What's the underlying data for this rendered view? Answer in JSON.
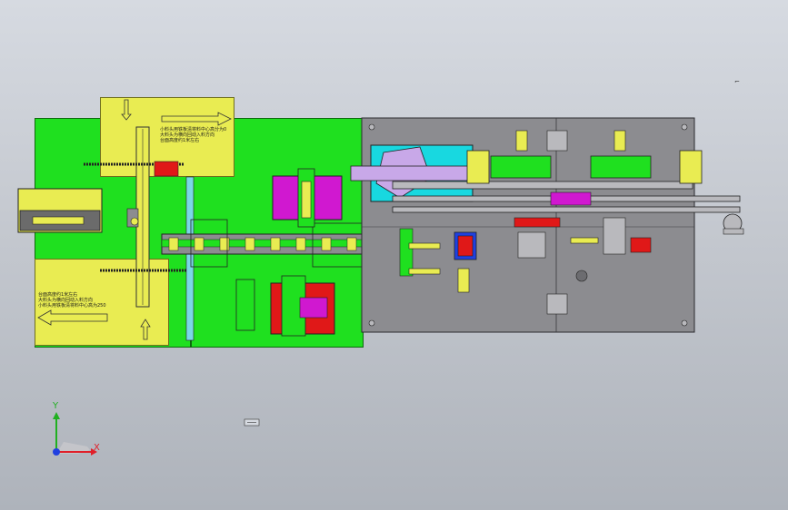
{
  "cad": {
    "view_mark": "⌐",
    "notes": {
      "top_block": {
        "line1": "小料头用铁板清将料中心高分为0",
        "line2": "大料头为横向回动入料方向",
        "line3": "台面高度约1米左右"
      },
      "bottom_block": {
        "line1": "台面高度约1米左右",
        "line2": "大料头为横向回动入料方向",
        "line3": "小料头用铁板清将料中心高为250"
      }
    },
    "axis": {
      "x_label": "X",
      "y_label": "Y",
      "x_color": "#e0202a",
      "y_color": "#20b020",
      "z_color": "#2040e0"
    },
    "colors": {
      "green": "#1fe01f",
      "yellow": "#e9ec52",
      "gray": "#8c8c90",
      "magenta": "#d018d0",
      "cyan": "#18d8e0",
      "red": "#e01818",
      "violet": "#c8a8e8"
    }
  }
}
